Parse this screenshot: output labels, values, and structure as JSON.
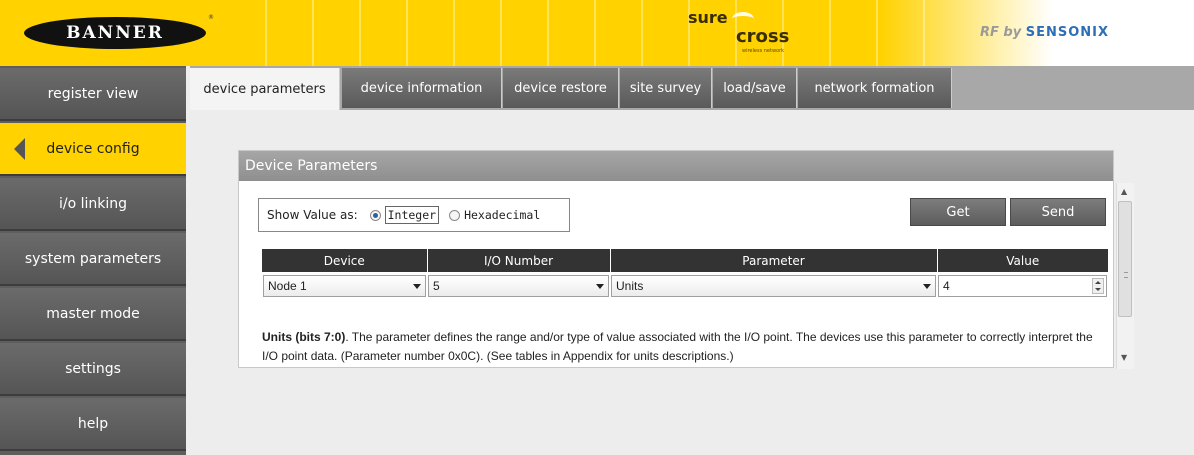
{
  "header": {
    "brand_logo": "BANNER",
    "brand_reg": "®",
    "product_sure": "sure",
    "product_cross": "cross",
    "product_sub": "wireless network",
    "partner_prefix": "RF by",
    "partner_name": "SENSONIX"
  },
  "sidebar": {
    "items": [
      {
        "label": "register view"
      },
      {
        "label": "device config",
        "active": true
      },
      {
        "label": "i/o linking"
      },
      {
        "label": "system parameters"
      },
      {
        "label": "master mode"
      },
      {
        "label": "settings"
      },
      {
        "label": "help"
      }
    ]
  },
  "tabs": [
    {
      "label": "device parameters",
      "active": true
    },
    {
      "label": "device information"
    },
    {
      "label": "device restore"
    },
    {
      "label": "site survey"
    },
    {
      "label": "load/save"
    },
    {
      "label": "network formation"
    }
  ],
  "panel": {
    "title": "Device Parameters",
    "show_value_label": "Show Value as:",
    "radio_integer": "Integer",
    "radio_hex": "Hexadecimal",
    "selected_format": "Integer",
    "get_label": "Get",
    "send_label": "Send"
  },
  "table": {
    "headers": [
      "Device",
      "I/O Number",
      "Parameter",
      "Value"
    ],
    "row": {
      "device": "Node 1",
      "io_number": "5",
      "parameter": "Units",
      "value": "4"
    }
  },
  "description": {
    "bold": "Units (bits 7:0)",
    "text": ". The parameter defines the range and/or type of value associated with the I/O point. The devices use this parameter to correctly interpret the I/O point data. (Parameter number 0x0C). (See tables in Appendix for units descriptions.)"
  },
  "icons": {
    "scroll_up": "up-arrow-icon",
    "scroll_down": "down-arrow-icon",
    "dropdown": "chevron-down-icon",
    "active_pointer": "left-pointer-icon"
  },
  "colors": {
    "brand_yellow": "#ffd200",
    "sidebar_gray": "#5e5e5e",
    "header_dark": "#333333",
    "sensonix_blue": "#2d6fb7"
  }
}
